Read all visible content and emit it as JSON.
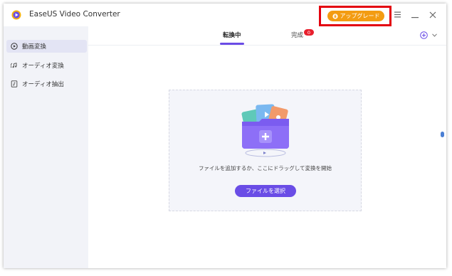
{
  "app": {
    "title": "EaseUS Video Converter",
    "upgrade_label": "アップグレード"
  },
  "sidebar": {
    "items": [
      {
        "label": "動画変換",
        "icon": "video-convert-icon",
        "active": true
      },
      {
        "label": "オーディオ変換",
        "icon": "audio-convert-icon",
        "active": false
      },
      {
        "label": "オーディオ抽出",
        "icon": "audio-extract-icon",
        "active": false
      }
    ]
  },
  "tabs": [
    {
      "label": "転換中",
      "active": true
    },
    {
      "label": "完成",
      "active": false,
      "badge": "0"
    }
  ],
  "dropzone": {
    "hint": "ファイルを追加するか、ここにドラッグして変換を開始",
    "button_label": "ファイルを選択"
  },
  "colors": {
    "accent": "#6a4de6",
    "upgrade": "#f39c12",
    "highlight_border": "#e3000f",
    "badge": "#e8202e",
    "sidebar_bg": "#f2f3f8"
  }
}
